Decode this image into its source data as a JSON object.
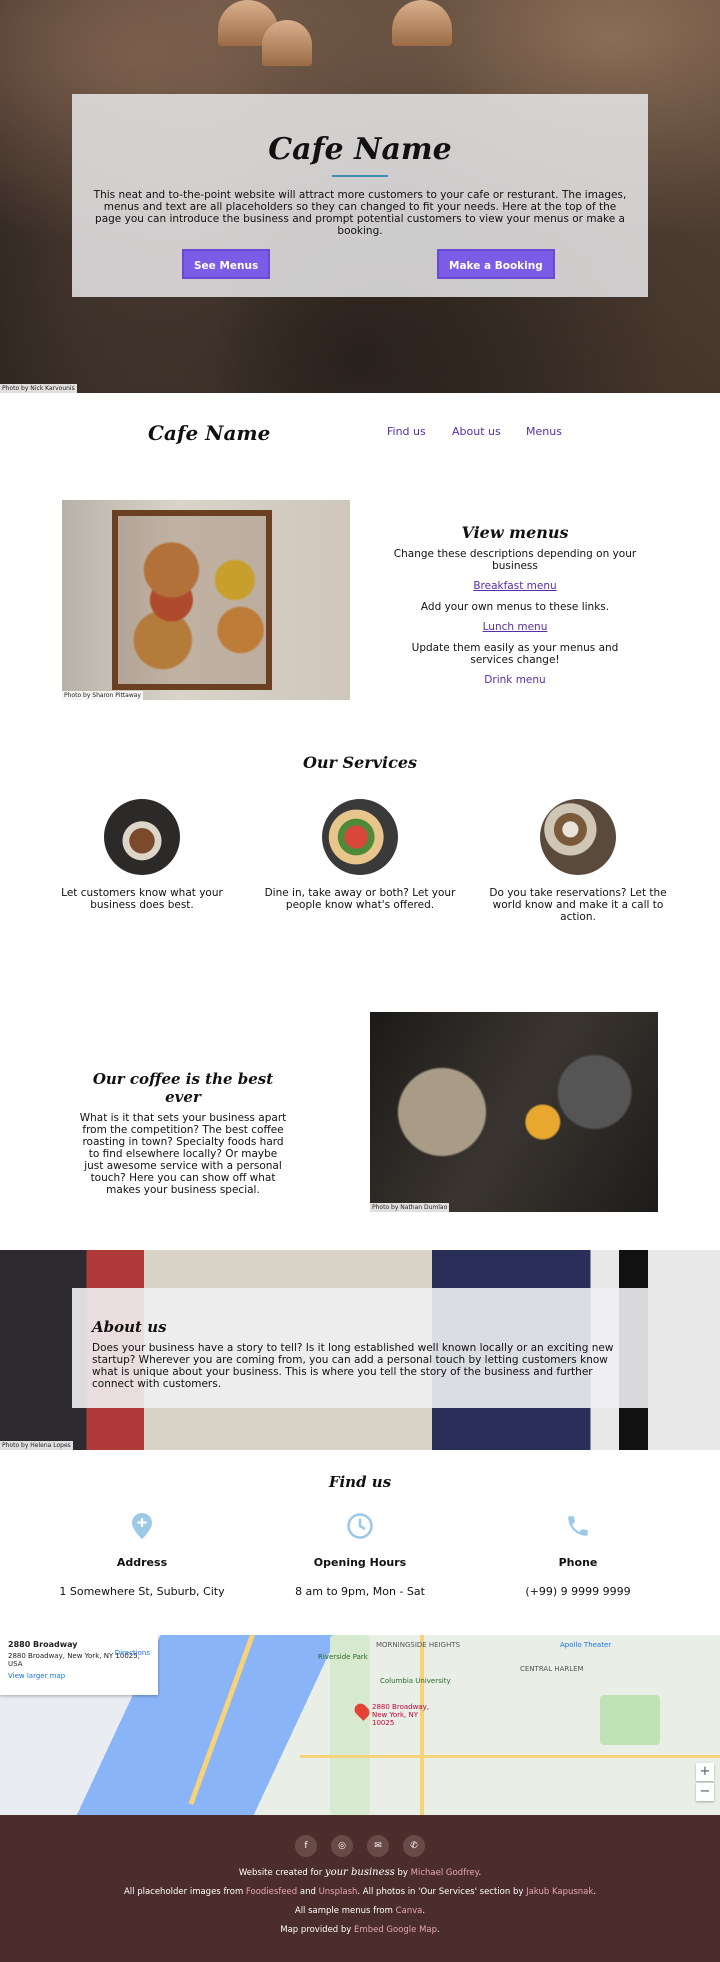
{
  "hero": {
    "title": "Cafe Name",
    "description": "This neat and to-the-point website will attract more customers to your cafe or resturant. The images, menus and text are all placeholders so they can changed to fit your needs. Here at the top of the page you can introduce the business and prompt potential customers to view your menus or make a booking.",
    "see_menus": "See Menus",
    "make_booking": "Make a Booking",
    "photo_credit": "Photo by Nick Karvounis"
  },
  "nav": {
    "brand": "Cafe Name",
    "links": [
      "Find us",
      "About us",
      "Menus"
    ]
  },
  "menus": {
    "photo_credit": "Photo by Sharon Pittaway",
    "title": "View menus",
    "line1": "Change these descriptions depending on your business",
    "link1": "Breakfast menu",
    "line2": "Add your own menus to these links.",
    "link2": "Lunch menu",
    "line3": "Update them easily as your menus and services change!",
    "link3": "Drink menu"
  },
  "services": {
    "title": "Our Services",
    "items": [
      {
        "text": "Let customers know what your business does best."
      },
      {
        "text": "Dine in, take away or both? Let your people know what's offered."
      },
      {
        "text": "Do you take reservations? Let the world know and make it a call to action."
      }
    ]
  },
  "coffee": {
    "title": "Our coffee is the best ever",
    "text": "What is it that sets your business apart from the competition? The best coffee roasting in town? Specialty foods hard to find elsewhere locally? Or maybe just awesome service with a personal touch? Here you can show off what makes your business special.",
    "photo_credit": "Photo by Nathan Dumlao"
  },
  "about": {
    "title": "About us",
    "text": "Does your business have a story to tell? Is it long established well known locally or an exciting new startup? Wherever you are coming from, you can add a personal touch by letting customers know what is unique about your business. This is where you tell the story of the business and further connect with customers.",
    "photo_credit": "Photo by Helena Lopes"
  },
  "findus": {
    "title": "Find us",
    "address_label": "Address",
    "address_value": "1 Somewhere St, Suburb, City",
    "hours_label": "Opening Hours",
    "hours_value": "8 am to 9pm, Mon - Sat",
    "phone_label": "Phone",
    "phone_value": "(+99) 9 9999 9999"
  },
  "map": {
    "card_title": "2880 Broadway",
    "card_address": "2880 Broadway, New York, NY 10025, USA",
    "directions": "Directions",
    "larger_map": "View larger map",
    "pin_label": "2880 Broadway, New York, NY 10025",
    "areas": [
      "MORNINGSIDE HEIGHTS",
      "CENTRAL HARLEM",
      "Columbia University",
      "Apollo Theater",
      "Riverside Park"
    ]
  },
  "footer": {
    "credit_prefix": "Website created for",
    "credit_em": "your business",
    "credit_by": "by",
    "credit_author": "Michael Godfrey",
    "images_prefix": "All placeholder images from",
    "images_a": "Foodiesfeed",
    "images_and": "and",
    "images_b": "Unsplash",
    "images_mid": ". All photos in 'Our Services' section by",
    "images_c": "Jakub Kapusnak",
    "menus_prefix": "All sample menus from",
    "menus_link": "Canva",
    "map_prefix": "Map provided by",
    "map_link": "Embed Google Map"
  },
  "colors": {
    "accent": "#7b5ce6",
    "link": "#5a2ea6",
    "icon": "#9cc9e6",
    "footer_bg": "#4b2e2c"
  }
}
